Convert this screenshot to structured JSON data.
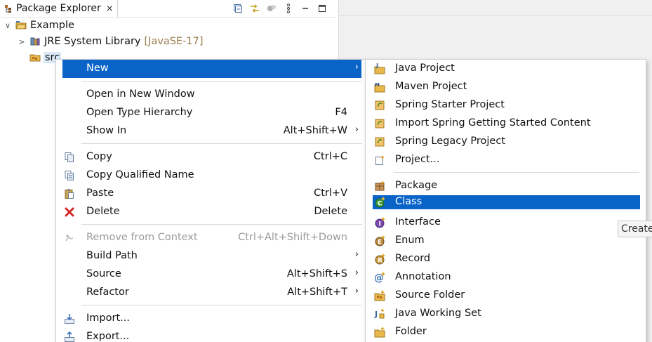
{
  "view": {
    "tab_title": "Package Explorer",
    "close_glyph": "×"
  },
  "tree": {
    "project": {
      "toggle": "∨",
      "label": "Example"
    },
    "jre": {
      "toggle": ">",
      "label": "JRE System Library",
      "decoration": "[JavaSE-17]"
    },
    "src": {
      "label": "src"
    }
  },
  "context_menu": {
    "new": {
      "label": "New",
      "arrow": "›"
    },
    "open_new_window": {
      "label": "Open in New Window"
    },
    "open_type_hierarchy": {
      "label": "Open Type Hierarchy",
      "accel": "F4"
    },
    "show_in": {
      "label": "Show In",
      "accel": "Alt+Shift+W",
      "arrow": "›"
    },
    "copy": {
      "label": "Copy",
      "accel": "Ctrl+C"
    },
    "copy_qualified": {
      "label": "Copy Qualified Name"
    },
    "paste": {
      "label": "Paste",
      "accel": "Ctrl+V"
    },
    "delete": {
      "label": "Delete",
      "accel": "Delete"
    },
    "remove_context": {
      "label": "Remove from Context",
      "accel": "Ctrl+Alt+Shift+Down"
    },
    "build_path": {
      "label": "Build Path",
      "arrow": "›"
    },
    "source": {
      "label": "Source",
      "accel": "Alt+Shift+S",
      "arrow": "›"
    },
    "refactor": {
      "label": "Refactor",
      "accel": "Alt+Shift+T",
      "arrow": "›"
    },
    "import": {
      "label": "Import..."
    },
    "export": {
      "label": "Export..."
    }
  },
  "new_submenu": {
    "java_project": "Java Project",
    "maven_project": "Maven Project",
    "spring_starter": "Spring Starter Project",
    "import_spring": "Import Spring Getting Started Content",
    "spring_legacy": "Spring Legacy Project",
    "project": "Project...",
    "package": "Package",
    "class": "Class",
    "interface": "Interface",
    "enum": "Enum",
    "record": "Record",
    "annotation": "Annotation",
    "source_folder": "Source Folder",
    "java_working_set": "Java Working Set",
    "folder": "Folder"
  },
  "tooltip": {
    "text": "Create"
  },
  "colors": {
    "highlight": "#0a64c8",
    "decoration": "#9a7a4a",
    "selection": "#d9e8f7"
  }
}
